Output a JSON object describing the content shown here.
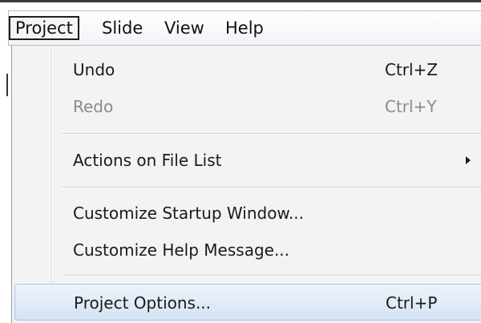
{
  "menubar": {
    "items": [
      {
        "label": "Project",
        "open": true
      },
      {
        "label": "Slide"
      },
      {
        "label": "View"
      },
      {
        "label": "Help"
      }
    ]
  },
  "menu": {
    "items": [
      {
        "label": "Undo",
        "shortcut": "Ctrl+Z",
        "enabled": true
      },
      {
        "label": "Redo",
        "shortcut": "Ctrl+Y",
        "enabled": false
      },
      {
        "label": "Actions on File List",
        "submenu": true,
        "enabled": true
      },
      {
        "label": "Customize Startup Window...",
        "enabled": true
      },
      {
        "label": "Customize Help Message...",
        "enabled": true
      },
      {
        "label": "Project Options...",
        "shortcut": "Ctrl+P",
        "enabled": true,
        "highlighted": true
      }
    ]
  },
  "colors": {
    "highlight_top": "#eef3fb",
    "highlight_bottom": "#d6e3f3",
    "highlight_border": "#a9c4e4",
    "disabled_text": "#8b8b8b",
    "menu_background": "#f3f3f3"
  }
}
